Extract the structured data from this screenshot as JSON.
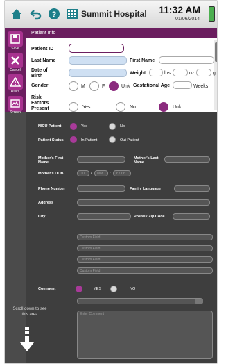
{
  "app": {
    "title": "Summit Hospital",
    "time": "11:32 AM",
    "date": "01/06/2014"
  },
  "panel": {
    "header": "Patient Info"
  },
  "sidebar": [
    {
      "label": "Save",
      "icon": "save-icon"
    },
    {
      "label": "Cancel",
      "icon": "cancel-icon"
    },
    {
      "label": "Risks",
      "icon": "warning-icon"
    },
    {
      "label": "Screen",
      "icon": "screen-icon"
    }
  ],
  "form": {
    "patient_id": "Patient ID",
    "last_name": "Last Name",
    "first_name": "First Name",
    "dob": "Date of Birth",
    "weight": "Weight",
    "lbs": "lbs",
    "oz": "oz",
    "g": "g",
    "gender": "Gender",
    "gender_m": "M",
    "gender_f": "F",
    "gender_unk": "Unk",
    "gest_age": "Gestational Age",
    "weeks": "Weeks",
    "risk": "Risk Factors Present",
    "risk_yes": "Yes",
    "risk_no": "No",
    "risk_unk": "Unk"
  },
  "dimmed": {
    "nicu": "NICU Patient",
    "nicu_yes": "Yes",
    "nicu_no": "No",
    "status": "Patient Status",
    "in_patient": "In Patient",
    "out_patient": "Out Patient",
    "mother_first": "Mother's First Name",
    "mother_last": "Mother's Last Name",
    "mother_dob": "Mother's DOB",
    "dd": "DD",
    "mm": "MM",
    "yyyy": "YYYY",
    "phone": "Phone Number",
    "family_lang": "Family Language",
    "address": "Address",
    "city": "City",
    "postal": "Postal / Zip Code",
    "custom": [
      "Custom Field",
      "Custom Field",
      "Custom Field",
      "Custom Field"
    ],
    "comment": "Comment",
    "yes": "YES",
    "no": "NO",
    "enter_comment": "Enter Comment"
  },
  "hint": "Scroll down to see this area"
}
